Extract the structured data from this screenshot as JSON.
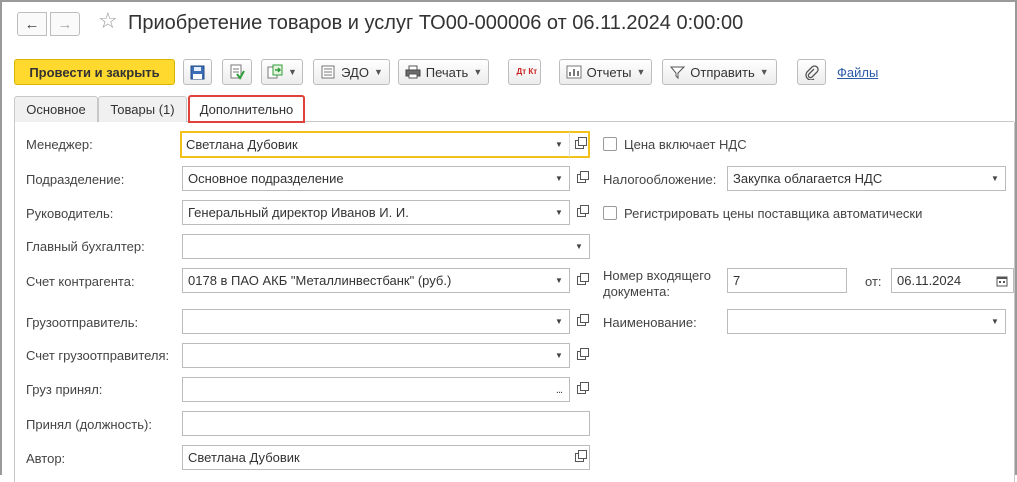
{
  "window": {
    "title": "Приобретение товаров и услуг ТО00-000006 от 06.11.2024 0:00:00"
  },
  "toolbar": {
    "post_close_label": "Провести и закрыть",
    "edo_label": "ЭДО",
    "print_label": "Печать",
    "dt_kt_label": "Дт Кт",
    "reports_label": "Отчеты",
    "send_label": "Отправить",
    "files_link": "Файлы"
  },
  "tabs": [
    {
      "label": "Основное"
    },
    {
      "label": "Товары (1)"
    },
    {
      "label": "Дополнительно",
      "active": true
    }
  ],
  "form": {
    "manager": {
      "label": "Менеджер:",
      "value": "Светлана Дубовик"
    },
    "department": {
      "label": "Подразделение:",
      "value": "Основное подразделение"
    },
    "head": {
      "label": "Руководитель:",
      "value": "Генеральный директор Иванов И. И."
    },
    "chief_accountant": {
      "label": "Главный бухгалтер:",
      "value": ""
    },
    "counterparty_account": {
      "label": "Счет контрагента:",
      "value": "0178 в ПАО АКБ \"Металлинвестбанк\" (руб.)"
    },
    "shipper": {
      "label": "Грузоотправитель:",
      "value": ""
    },
    "shipper_account": {
      "label": "Счет грузоотправителя:",
      "value": ""
    },
    "cargo_received": {
      "label": "Груз принял:",
      "value": ""
    },
    "received_position": {
      "label": "Принял (должность):",
      "value": ""
    },
    "author": {
      "label": "Автор:",
      "value": "Светлана Дубовик"
    },
    "price_includes_vat": {
      "label": "Цена включает НДС",
      "checked": false
    },
    "taxation": {
      "label": "Налогообложение:",
      "value": "Закупка облагается НДС"
    },
    "register_prices": {
      "label": "Регистрировать цены поставщика автоматически",
      "checked": false
    },
    "incoming_doc": {
      "label_line1": "Номер входящего",
      "label_line2": "документа:",
      "number": "7",
      "from_label": "от:",
      "date": "06.11.2024"
    },
    "name": {
      "label": "Наименование:",
      "value": ""
    }
  },
  "colors": {
    "primary_button": "#ffd92e",
    "active_tab_border": "#e0413a",
    "focus_border": "#f2c21a",
    "link": "#2a5aa8"
  }
}
